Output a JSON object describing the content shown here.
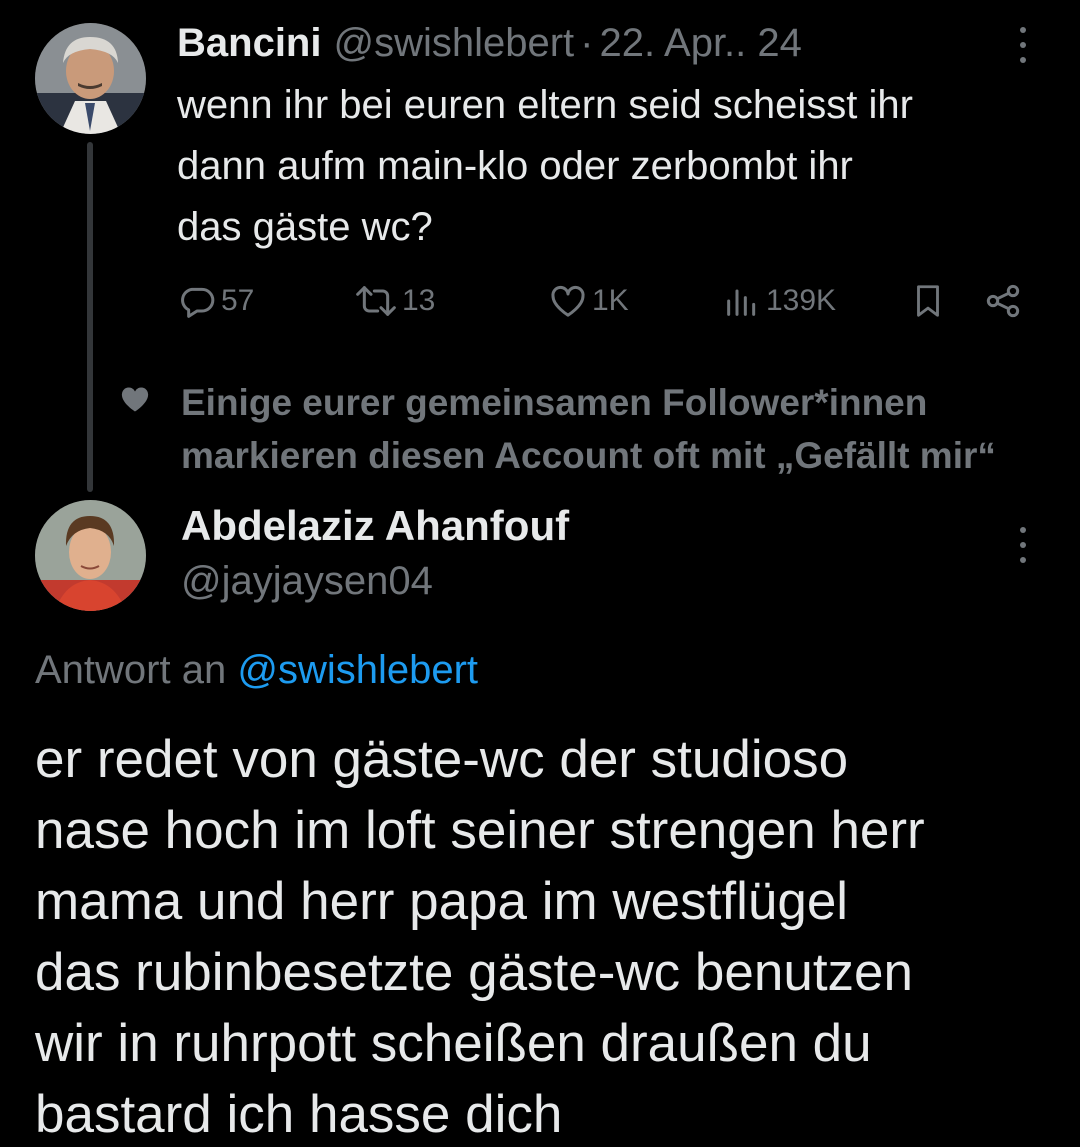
{
  "parent_tweet": {
    "author_name": "Bancini",
    "author_handle": "@swishlebert",
    "separator": "·",
    "date": "22. Apr.. 24",
    "text": "wenn ihr bei euren eltern seid scheisst ihr\ndann aufm main-klo oder zerbombt ihr\ndas gäste wc?",
    "actions": {
      "replies": "57",
      "reposts": "13",
      "likes": "1K",
      "views": "139K"
    }
  },
  "social_context": {
    "text": "Einige eurer gemeinsamen Follower*innen\nmarkieren diesen Account oft mit „Gefällt mir“",
    "icon": "heart-icon"
  },
  "reply_tweet": {
    "author_name": "Abdelaziz Ahanfouf",
    "author_handle": "@jayjaysen04",
    "reply_prefix": "Antwort an",
    "reply_to_handle": "@swishlebert",
    "text": "er redet von gäste-wc der studioso\nnase hoch im loft seiner strengen herr\nmama und herr papa im westflügel\ndas rubinbesetzte gäste-wc benutzen\nwir in ruhrpott scheißen draußen du\nbastard ich hasse dich"
  },
  "colors": {
    "background": "#000000",
    "primary_text": "#e7e9ea",
    "secondary_text": "#71767b",
    "link": "#1d9bf0"
  }
}
